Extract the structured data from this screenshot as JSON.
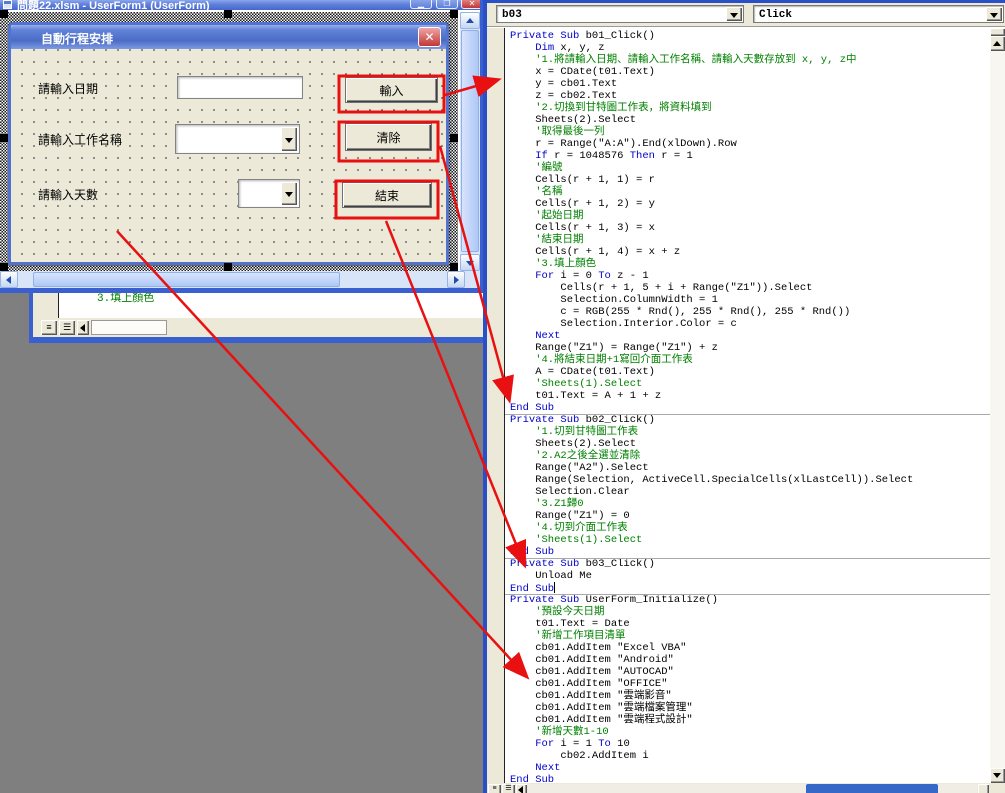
{
  "titlebar": {
    "title": "問題22.xlsm - UserForm1 (UserForm)"
  },
  "designer": {
    "form_caption": "自動行程安排",
    "close_glyph": "✕",
    "rows": [
      {
        "label": "請輸入日期",
        "control": "textbox",
        "value": ""
      },
      {
        "label": "請輸入工作名稱",
        "control": "combobox",
        "value": ""
      },
      {
        "label": "請輸入天數",
        "control": "combobox",
        "value": ""
      }
    ],
    "action_buttons": [
      "輸入",
      "清除",
      "結束"
    ]
  },
  "background_code_window": {
    "visible_line": "3.填上顏色"
  },
  "code_window": {
    "object_selector": "b03",
    "event_selector": "Click",
    "caret_line": 46,
    "separators_after": [
      31,
      43,
      46
    ],
    "lines": [
      [
        [
          "k",
          "Private Sub "
        ],
        [
          "n",
          "b01_Click()"
        ]
      ],
      [
        [
          "n",
          "    "
        ],
        [
          "k",
          "Dim"
        ],
        [
          "n",
          " x, y, z"
        ]
      ],
      [
        [
          "c",
          "    '1.將請輸入日期、請輸入工作名稱、請輸入天數存放到 x, y, z中"
        ]
      ],
      [
        [
          "n",
          "    x = CDate(t01.Text)"
        ]
      ],
      [
        [
          "n",
          "    y = cb01.Text"
        ]
      ],
      [
        [
          "n",
          "    z = cb02.Text"
        ]
      ],
      [
        [
          "c",
          "    '2.切換到甘特圖工作表，將資料填到"
        ]
      ],
      [
        [
          "n",
          "    Sheets(2).Select"
        ]
      ],
      [
        [
          "c",
          "    '取得最後一列"
        ]
      ],
      [
        [
          "n",
          "    r = Range(\"A:A\").End(xlDown).Row"
        ]
      ],
      [
        [
          "n",
          "    "
        ],
        [
          "k",
          "If"
        ],
        [
          "n",
          " r = 1048576 "
        ],
        [
          "k",
          "Then"
        ],
        [
          "n",
          " r = 1"
        ]
      ],
      [
        [
          "c",
          "    '編號"
        ]
      ],
      [
        [
          "n",
          "    Cells(r + 1, 1) = r"
        ]
      ],
      [
        [
          "c",
          "    '名稱"
        ]
      ],
      [
        [
          "n",
          "    Cells(r + 1, 2) = y"
        ]
      ],
      [
        [
          "c",
          "    '起始日期"
        ]
      ],
      [
        [
          "n",
          "    Cells(r + 1, 3) = x"
        ]
      ],
      [
        [
          "c",
          "    '結束日期"
        ]
      ],
      [
        [
          "n",
          "    Cells(r + 1, 4) = x + z"
        ]
      ],
      [
        [
          "c",
          "    '3.填上顏色"
        ]
      ],
      [
        [
          "n",
          "    "
        ],
        [
          "k",
          "For"
        ],
        [
          "n",
          " i = 0 "
        ],
        [
          "k",
          "To"
        ],
        [
          "n",
          " z - 1"
        ]
      ],
      [
        [
          "n",
          "        Cells(r + 1, 5 + i + Range(\"Z1\")).Select"
        ]
      ],
      [
        [
          "n",
          "        Selection.ColumnWidth = 1"
        ]
      ],
      [
        [
          "n",
          "        c = RGB(255 * Rnd(), 255 * Rnd(), 255 * Rnd())"
        ]
      ],
      [
        [
          "n",
          "        Selection.Interior.Color = c"
        ]
      ],
      [
        [
          "n",
          "    "
        ],
        [
          "k",
          "Next"
        ]
      ],
      [
        [
          "n",
          "    Range(\"Z1\") = Range(\"Z1\") + z"
        ]
      ],
      [
        [
          "c",
          "    '4.將結束日期+1寫回介面工作表"
        ]
      ],
      [
        [
          "n",
          "    A = CDate(t01.Text)"
        ]
      ],
      [
        [
          "c",
          "    'Sheets(1).Select"
        ]
      ],
      [
        [
          "n",
          "    t01.Text = A + 1 + z"
        ]
      ],
      [
        [
          "k",
          "End Sub"
        ]
      ],
      [
        [
          "k",
          "Private Sub "
        ],
        [
          "n",
          "b02_Click()"
        ]
      ],
      [
        [
          "c",
          "    '1.切到甘特圖工作表"
        ]
      ],
      [
        [
          "n",
          "    Sheets(2).Select"
        ]
      ],
      [
        [
          "c",
          "    '2.A2之後全選並清除"
        ]
      ],
      [
        [
          "n",
          "    Range(\"A2\").Select"
        ]
      ],
      [
        [
          "n",
          "    Range(Selection, ActiveCell.SpecialCells(xlLastCell)).Select"
        ]
      ],
      [
        [
          "n",
          "    Selection.Clear"
        ]
      ],
      [
        [
          "c",
          "    '3.Z1歸0"
        ]
      ],
      [
        [
          "n",
          "    Range(\"Z1\") = 0"
        ]
      ],
      [
        [
          "c",
          "    '4.切到介面工作表"
        ]
      ],
      [
        [
          "c",
          "    'Sheets(1).Select"
        ]
      ],
      [
        [
          "k",
          "End Sub"
        ]
      ],
      [
        [
          "k",
          "Private Sub "
        ],
        [
          "n",
          "b03_Click()"
        ]
      ],
      [
        [
          "n",
          "    Unload Me"
        ]
      ],
      [
        [
          "k",
          "End Sub"
        ]
      ],
      [
        [
          "k",
          "Private Sub "
        ],
        [
          "n",
          "UserForm_Initialize()"
        ]
      ],
      [
        [
          "c",
          "    '預設今天日期"
        ]
      ],
      [
        [
          "n",
          "    t01.Text = Date"
        ]
      ],
      [
        [
          "c",
          "    '新增工作項目清單"
        ]
      ],
      [
        [
          "n",
          "    cb01.AddItem \"Excel VBA\""
        ]
      ],
      [
        [
          "n",
          "    cb01.AddItem \"Android\""
        ]
      ],
      [
        [
          "n",
          "    cb01.AddItem \"AUTOCAD\""
        ]
      ],
      [
        [
          "n",
          "    cb01.AddItem \"OFFICE\""
        ]
      ],
      [
        [
          "n",
          "    cb01.AddItem \"雲端影音\""
        ]
      ],
      [
        [
          "n",
          "    cb01.AddItem \"雲端檔案管理\""
        ]
      ],
      [
        [
          "n",
          "    cb01.AddItem \"雲端程式設計\""
        ]
      ],
      [
        [
          "c",
          "    '新增天數1-10"
        ]
      ],
      [
        [
          "n",
          "    "
        ],
        [
          "k",
          "For"
        ],
        [
          "n",
          " i = 1 "
        ],
        [
          "k",
          "To"
        ],
        [
          "n",
          " 10"
        ]
      ],
      [
        [
          "n",
          "        cb02.AddItem i"
        ]
      ],
      [
        [
          "n",
          "    "
        ],
        [
          "k",
          "Next"
        ]
      ],
      [
        [
          "k",
          "End Sub"
        ]
      ]
    ]
  },
  "colors": {
    "annotation_red": "#e81010",
    "keyword_blue": "#0000c8",
    "comment_green": "#008000",
    "mdi_gray": "#7f7f7f",
    "panel_beige": "#ece9d8"
  }
}
